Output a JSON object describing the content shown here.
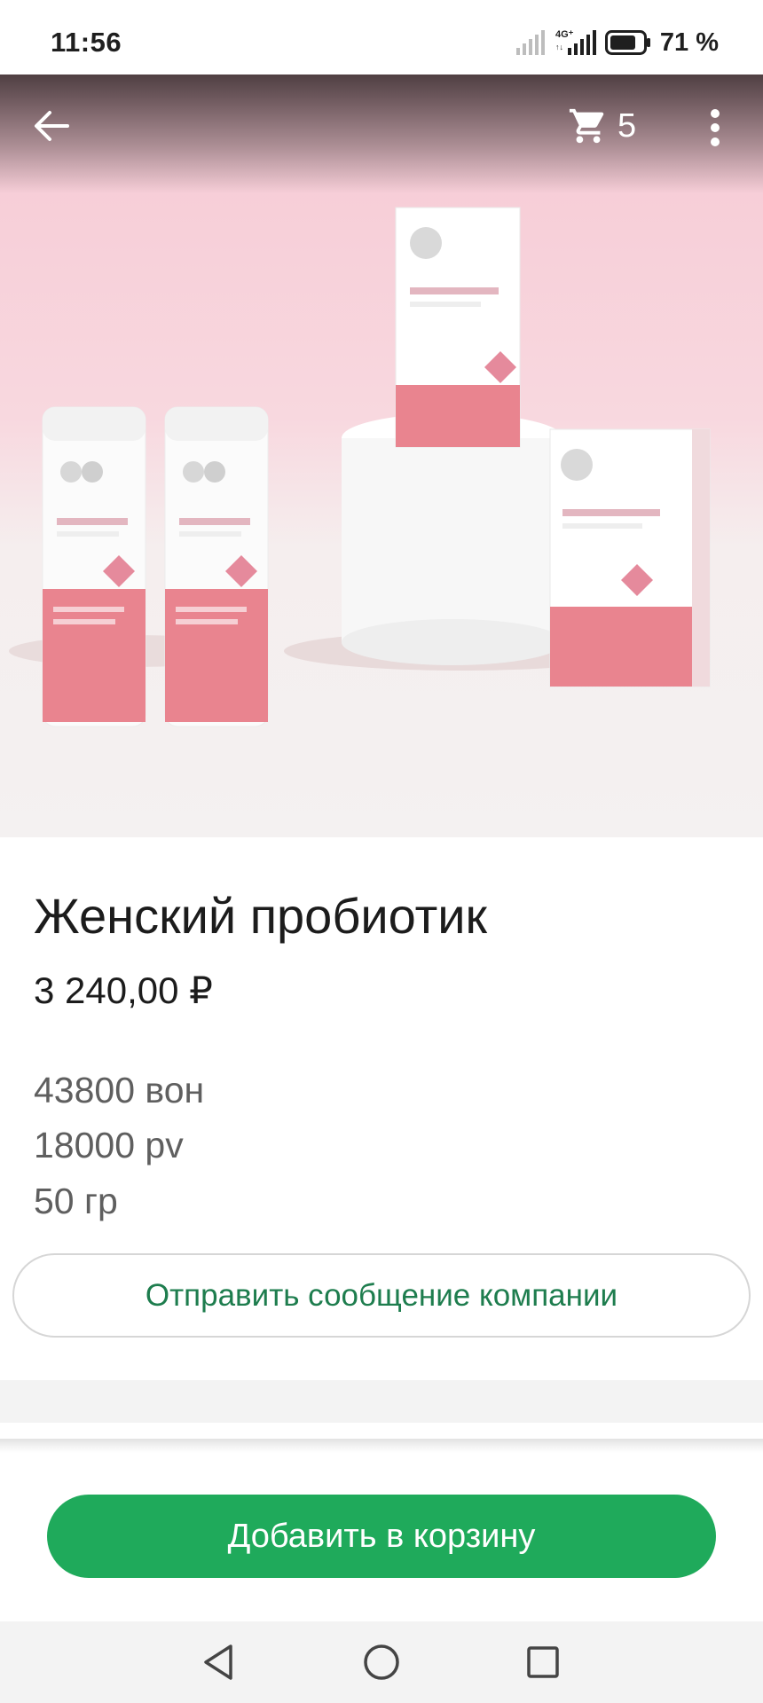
{
  "status_bar": {
    "time": "11:56",
    "network": "4G+",
    "battery": "71 %",
    "icons": [
      "signal-weak-icon",
      "signal-4g-icon",
      "battery-icon"
    ]
  },
  "toolbar": {
    "back_icon": "arrow-left-icon",
    "cart_icon": "cart-icon",
    "cart_count": "5",
    "more_icon": "more-vertical-icon"
  },
  "product": {
    "title": "Женский пробиотик",
    "price": "3 240,00 ₽",
    "description": [
      "43800 вон",
      "18000 pv",
      "50 гр"
    ]
  },
  "actions": {
    "message_label": "Отправить сообщение компании",
    "add_to_cart_label": "Добавить в корзину"
  },
  "nav_bar": {
    "icons": [
      "nav-back-icon",
      "nav-home-icon",
      "nav-recents-icon"
    ]
  },
  "colors": {
    "accent_green": "#1faa5b",
    "text_green": "#1e7d4e",
    "hero_pink": "#f6c9d4"
  }
}
